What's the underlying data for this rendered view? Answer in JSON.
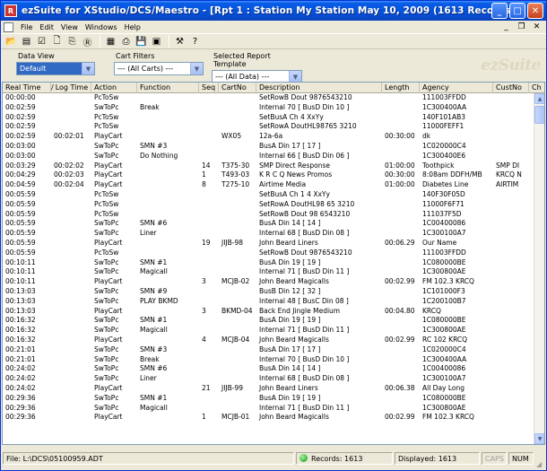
{
  "window": {
    "title": "ezSuite for XStudio/DCS/Maestro - [Rpt 1 :  Station My Station May 10, 2009 (1613 Records)]",
    "app_icon": "R",
    "minimize": "_",
    "maximize": "□",
    "close": "✕"
  },
  "menu": {
    "items": [
      "File",
      "Edit",
      "View",
      "Windows",
      "Help"
    ],
    "mdi_minimize": "_",
    "mdi_restore": "❐",
    "mdi_close": "✕"
  },
  "toolbar": {
    "buttons": [
      {
        "icon": "open-folder-icon",
        "glyph": "📂"
      },
      {
        "icon": "report-icon",
        "glyph": "▤"
      },
      {
        "icon": "list-icon",
        "glyph": "☑"
      },
      {
        "icon": "new-document-icon",
        "glyph": "🗋"
      },
      {
        "icon": "copy-icon",
        "glyph": "⎘"
      },
      {
        "icon": "record-icon",
        "glyph": "Ⓡ"
      },
      {
        "icon": "table-icon",
        "glyph": "▦"
      },
      {
        "icon": "print-icon",
        "glyph": "⎙"
      },
      {
        "icon": "save-icon",
        "glyph": "💾"
      },
      {
        "icon": "export-icon",
        "glyph": "▣"
      },
      {
        "icon": "tools-icon",
        "glyph": "⚒"
      },
      {
        "icon": "help-icon",
        "glyph": "?"
      }
    ]
  },
  "filters": {
    "data_view_label": "Data View",
    "data_view_value": "Default",
    "cart_filters_label": "Cart Filters",
    "cart_filters_value": "--- (All Carts) ---",
    "report_template_label": "Selected Report Template",
    "report_template_value": "--- (All Data) ---"
  },
  "watermark": "ezSuite",
  "grid": {
    "columns": [
      "Real Time",
      "Log Time",
      "Action",
      "Function",
      "Seq",
      "CartNo",
      "Description",
      "Length",
      "Agency",
      "CustNo",
      "Ch"
    ],
    "sort_indicator": "/",
    "rows": [
      [
        "00:00:00",
        "",
        "PcToSw",
        "",
        "",
        "",
        "SetRowB Dout  9876543210",
        "",
        "111003FFDD",
        "",
        ""
      ],
      [
        "00:02:59",
        "",
        "SwToPc",
        "Break",
        "",
        "",
        "Internal 70 [ BusD Din 10 ]",
        "",
        "1C300400AA",
        "",
        ""
      ],
      [
        "00:02:59",
        "",
        "PcToSw",
        "",
        "",
        "",
        "SetBusA Ch   4   XxYy",
        "",
        "140F101AB3",
        "",
        ""
      ],
      [
        "00:02:59",
        "",
        "PcToSw",
        "",
        "",
        "",
        "SetRowA DoutHL98765 3210",
        "",
        "11000FEFF1",
        "",
        ""
      ],
      [
        "00:02:59",
        "00:02:01",
        "PlayCart",
        "",
        "",
        "WX05",
        "12a-6a",
        "00:30:00",
        "dk",
        "",
        ""
      ],
      [
        "00:03:00",
        "",
        "SwToPc",
        "SMN #3",
        "",
        "",
        "BusA Din 17 [ 17 ]",
        "",
        "1C020000C4",
        "",
        ""
      ],
      [
        "00:03:00",
        "",
        "SwToPc",
        "Do Nothing",
        "",
        "",
        "Internal 66 [ BusD Din 06 ]",
        "",
        "1C300400E6",
        "",
        ""
      ],
      [
        "00:03:29",
        "00:02:02",
        "PlayCart",
        "",
        "14",
        "T375-30",
        "SMP Direct Response",
        "01:00:00",
        "Toothpick",
        "SMP DI",
        ""
      ],
      [
        "00:04:29",
        "00:02:03",
        "PlayCart",
        "",
        "1",
        "T493-03",
        "K R C Q News Promos",
        "00:30:00",
        "8:08am DDFH/MB",
        "KRCQ N",
        ""
      ],
      [
        "00:04:59",
        "00:02:04",
        "PlayCart",
        "",
        "8",
        "T275-10",
        "Airtime Media",
        "01:00:00",
        "Diabetes Line",
        "AIRTIM",
        ""
      ],
      [
        "00:05:59",
        "",
        "PcToSw",
        "",
        "",
        "",
        "SetBusA Ch 1   4   XxYy",
        "",
        "140F30F05D",
        "",
        ""
      ],
      [
        "00:05:59",
        "",
        "PcToSw",
        "",
        "",
        "",
        "SetRowA DoutHL98 65 3210",
        "",
        "11000F6F71",
        "",
        ""
      ],
      [
        "00:05:59",
        "",
        "PcToSw",
        "",
        "",
        "",
        "SetRowB Dout  98 6543210",
        "",
        "111037F5D",
        "",
        ""
      ],
      [
        "00:05:59",
        "",
        "SwToPc",
        "SMN #6",
        "",
        "",
        "BusA Din 14 [ 14 ]",
        "",
        "1C00400086",
        "",
        ""
      ],
      [
        "00:05:59",
        "",
        "SwToPc",
        "Liner",
        "",
        "",
        "Internal 68 [ BusD Din 08 ]",
        "",
        "1C300100A7",
        "",
        ""
      ],
      [
        "00:05:59",
        "",
        "PlayCart",
        "",
        "19",
        "JIJB-98",
        "John Beard Liners",
        "00:06.29",
        "Our Name",
        "",
        ""
      ],
      [
        "00:05:59",
        "",
        "PcToSw",
        "",
        "",
        "",
        "SetRowB Dout  9876543210",
        "",
        "111003FFDD",
        "",
        ""
      ],
      [
        "00:10:11",
        "",
        "SwToPc",
        "SMN #1",
        "",
        "",
        "BusA Din 19 [ 19 ]",
        "",
        "1C080000BE",
        "",
        ""
      ],
      [
        "00:10:11",
        "",
        "SwToPc",
        "Magicall",
        "",
        "",
        "Internal 71 [ BusD Din 11 ]",
        "",
        "1C300800AE",
        "",
        ""
      ],
      [
        "00:10:11",
        "",
        "PlayCart",
        "",
        "3",
        "MCJB-02",
        "John Beard Magicalls",
        "00:02.99",
        "FM 102.3 KRCQ",
        "",
        ""
      ],
      [
        "00:13:03",
        "",
        "SwToPc",
        "SMN #9",
        "",
        "",
        "BusB Din 12 [ 32 ]",
        "",
        "1C101000F3",
        "",
        ""
      ],
      [
        "00:13:03",
        "",
        "SwToPc",
        "PLAY BKMD",
        "",
        "",
        "Internal 48 [ BusC Din 08 ]",
        "",
        "1C200100B7",
        "",
        ""
      ],
      [
        "00:13:03",
        "",
        "PlayCart",
        "",
        "3",
        "BKMD-04",
        "Back End Jingle Medium",
        "00:04.80",
        "KRCQ",
        "",
        ""
      ],
      [
        "00:16:32",
        "",
        "SwToPc",
        "SMN #1",
        "",
        "",
        "BusA Din 19 [ 19 ]",
        "",
        "1C080000BE",
        "",
        ""
      ],
      [
        "00:16:32",
        "",
        "SwToPc",
        "Magicall",
        "",
        "",
        "Internal 71 [ BusD Din 11 ]",
        "",
        "1C300800AE",
        "",
        ""
      ],
      [
        "00:16:32",
        "",
        "PlayCart",
        "",
        "4",
        "MCJB-04",
        "John Beard Magicalls",
        "00:02.99",
        "RC 102 KRCQ",
        "",
        ""
      ],
      [
        "00:21:01",
        "",
        "SwToPc",
        "SMN #3",
        "",
        "",
        "BusA Din 17 [ 17 ]",
        "",
        "1C020000C4",
        "",
        ""
      ],
      [
        "00:21:01",
        "",
        "SwToPc",
        "Break",
        "",
        "",
        "Internal 70 [ BusD Din 10 ]",
        "",
        "1C300400AA",
        "",
        ""
      ],
      [
        "00:24:02",
        "",
        "SwToPc",
        "SMN #6",
        "",
        "",
        "BusA Din 14 [ 14 ]",
        "",
        "1C00400086",
        "",
        ""
      ],
      [
        "00:24:02",
        "",
        "SwToPc",
        "Liner",
        "",
        "",
        "Internal 68 [ BusD Din 08 ]",
        "",
        "1C300100A7",
        "",
        ""
      ],
      [
        "00:24:02",
        "",
        "PlayCart",
        "",
        "21",
        "JIJB-99",
        "John Beard Liners",
        "00:06.38",
        "All Day Long",
        "",
        ""
      ],
      [
        "00:29:36",
        "",
        "SwToPc",
        "SMN #1",
        "",
        "",
        "BusA Din 19 [ 19 ]",
        "",
        "1C080000BE",
        "",
        ""
      ],
      [
        "00:29:36",
        "",
        "SwToPc",
        "Magicall",
        "",
        "",
        "Internal 71 [ BusD Din 11 ]",
        "",
        "1C300800AE",
        "",
        ""
      ],
      [
        "00:29:36",
        "",
        "PlayCart",
        "",
        "1",
        "MCJB-01",
        "John Beard Magicalls",
        "00:02.99",
        "FM 102.3 KRCQ",
        "",
        ""
      ]
    ]
  },
  "status": {
    "file": "File: L:\\DCS\\05100959.ADT",
    "records": "Records: 1613",
    "displayed": "Displayed: 1613",
    "caps": "CAPS",
    "num": "NUM",
    "grip": "◢"
  }
}
